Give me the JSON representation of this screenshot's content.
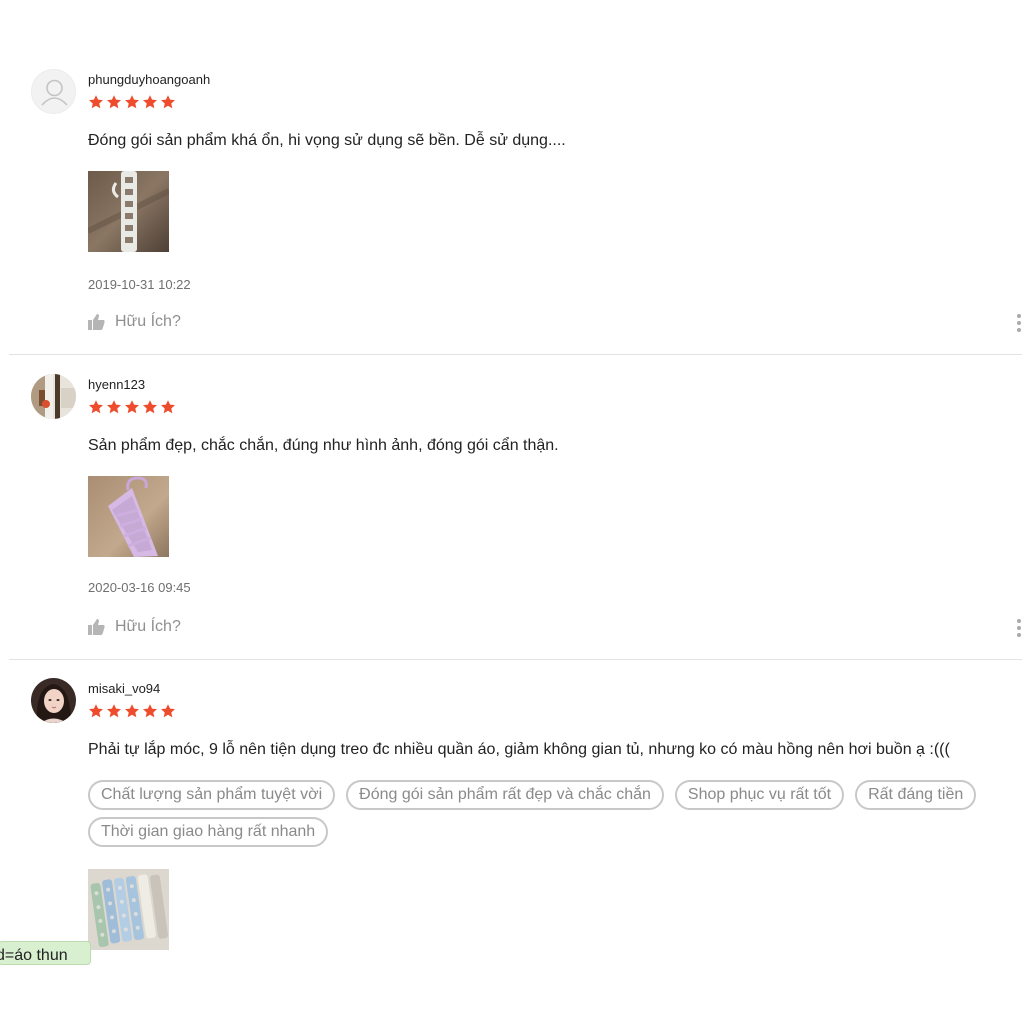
{
  "reviews": [
    {
      "username": "phungduyhoangoanh",
      "rating": 5,
      "comment": "Đóng gói sản phẩm khá ổn,  hi vọng sử dụng sẽ bền. Dễ sử dụng....",
      "tags": [],
      "timestamp": "2019-10-31 10:22",
      "helpful_label": "Hữu Ích?"
    },
    {
      "username": "hyenn123",
      "rating": 5,
      "comment": "Sản phẩm đẹp, chắc chắn, đúng như hình ảnh, đóng gói cẩn thận.",
      "tags": [],
      "timestamp": "2020-03-16 09:45",
      "helpful_label": "Hữu Ích?"
    },
    {
      "username": "misaki_vo94",
      "rating": 5,
      "comment": "Phải tự lắp móc, 9 lỗ nên tiện dụng treo đc nhiều quần áo, giảm không gian tủ, nhưng ko có màu hồng nên hơi buồn ạ :(((",
      "tags": [
        "Chất lượng sản phẩm tuyệt vời",
        "Đóng gói sản phẩm rất đẹp và chắc chắn",
        "Shop phục vụ rất tốt",
        "Rất đáng tiền",
        "Thời gian giao hàng rất nhanh"
      ]
    }
  ],
  "toast_text": "d=áo thun",
  "colors": {
    "star": "#ee4d2d",
    "tag_border": "#c8c8c8",
    "divider": "#e3e3e3"
  }
}
